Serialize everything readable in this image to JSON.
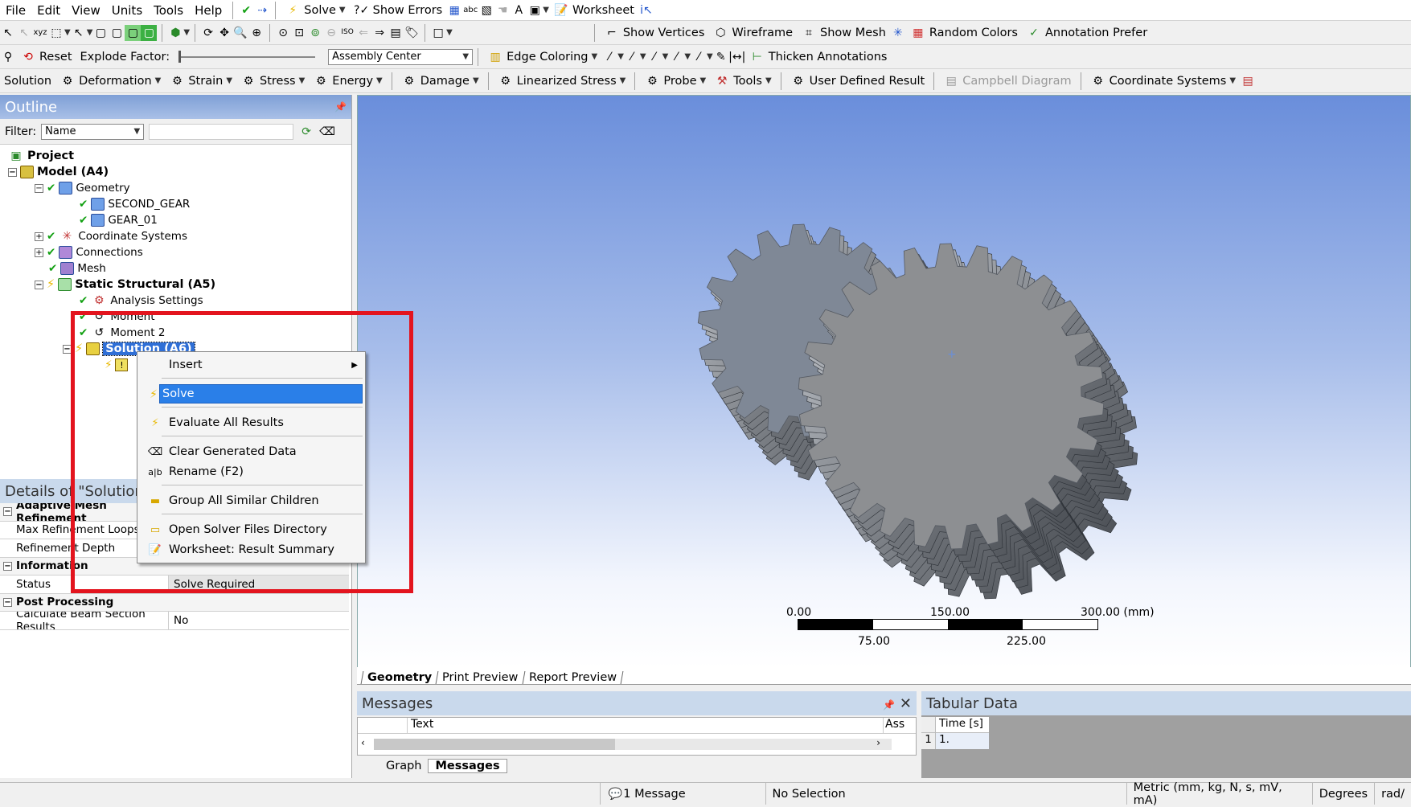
{
  "menubar": {
    "items": [
      "File",
      "Edit",
      "View",
      "Units",
      "Tools",
      "Help"
    ],
    "solve_label": "Solve",
    "show_errors_label": "Show Errors",
    "worksheet_label": "Worksheet"
  },
  "toolbar2": {
    "show_vertices": "Show Vertices",
    "wireframe": "Wireframe",
    "show_mesh": "Show Mesh",
    "random_colors": "Random Colors",
    "annotation_prefs": "Annotation Prefer"
  },
  "toolbar3": {
    "reset": "Reset",
    "explode_factor": "Explode Factor:",
    "assembly_center": "Assembly Center",
    "edge_coloring": "Edge Coloring",
    "thicken_annotations": "Thicken Annotations"
  },
  "toolbar4": {
    "solution": "Solution",
    "deformation": "Deformation",
    "strain": "Strain",
    "stress": "Stress",
    "energy": "Energy",
    "damage": "Damage",
    "linearized_stress": "Linearized Stress",
    "probe": "Probe",
    "tools": "Tools",
    "user_defined_result": "User Defined Result",
    "campbell_diagram": "Campbell Diagram",
    "coordinate_systems": "Coordinate Systems"
  },
  "outline": {
    "title": "Outline",
    "filter_label": "Filter:",
    "filter_value": "Name",
    "tree": {
      "project": "Project",
      "model": "Model (A4)",
      "geometry": "Geometry",
      "second_gear": "SECOND_GEAR",
      "gear_01": "GEAR_01",
      "coordinate_systems": "Coordinate Systems",
      "connections": "Connections",
      "mesh": "Mesh",
      "static_structural": "Static Structural (A5)",
      "analysis_settings": "Analysis Settings",
      "moment": "Moment",
      "moment2": "Moment 2",
      "solution": "Solution (A6)"
    }
  },
  "details": {
    "title": "Details of \"Solution (A6)\"",
    "title_visible": "Details of \"Solution",
    "groups": {
      "adaptive": "Adaptive Mesh Refinement",
      "information": "Information",
      "post_processing": "Post Processing"
    },
    "rows": {
      "max_refinement_loops": "Max Refinement Loops",
      "refinement_depth": "Refinement Depth",
      "status_key": "Status",
      "status_val": "Solve Required",
      "calc_beam_key": "Calculate Beam Section Results",
      "calc_beam_val": "No"
    }
  },
  "context_menu": {
    "insert": "Insert",
    "solve": "Solve",
    "evaluate_all": "Evaluate All Results",
    "clear_generated": "Clear Generated Data",
    "rename": "Rename (F2)",
    "group_similar": "Group All Similar Children",
    "open_solver_dir": "Open Solver Files Directory",
    "worksheet_summary": "Worksheet: Result Summary"
  },
  "scale_bar": {
    "top_labels": [
      "0.00",
      "150.00",
      "300.00 (mm)"
    ],
    "bottom_labels": [
      "75.00",
      "225.00"
    ]
  },
  "viewport_tabs": [
    "Geometry",
    "Print Preview",
    "Report Preview"
  ],
  "messages": {
    "title": "Messages",
    "col_text": "Text",
    "col_ass": "Ass",
    "tabs": [
      "Graph",
      "Messages"
    ]
  },
  "tabular": {
    "title": "Tabular Data",
    "col_time": "Time [s]",
    "row_index": "1",
    "row_value": "1."
  },
  "status_bar": {
    "messages": "1 Message",
    "selection": "No Selection",
    "units": "Metric (mm, kg, N, s, mV, mA)",
    "degrees": "Degrees",
    "rad": "rad/"
  },
  "colors": {
    "highlight": "#e3141e",
    "selection": "#2a7fe8",
    "gear_face": "#7f8896",
    "gear_face2": "#8d8f92"
  }
}
